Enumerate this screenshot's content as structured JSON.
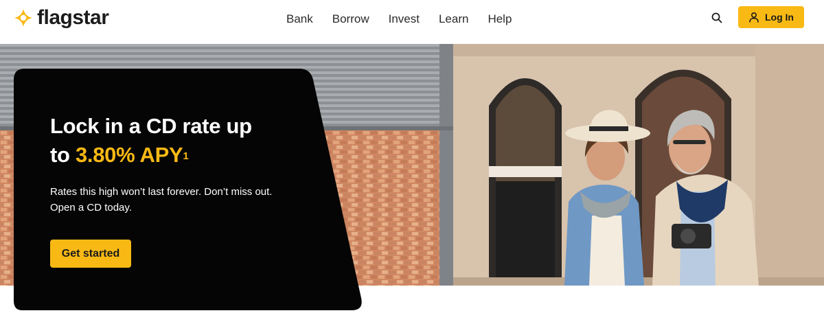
{
  "brand": {
    "name": "flagstar",
    "accent": "#f9b915"
  },
  "nav": {
    "items": [
      "Bank",
      "Borrow",
      "Invest",
      "Learn",
      "Help"
    ]
  },
  "header": {
    "search_icon": "search-icon",
    "login_label": "Log In",
    "login_icon": "user-icon"
  },
  "hero": {
    "title_line1": "Lock in a CD rate up",
    "title_prefix": "to ",
    "title_rate": "3.80% APY",
    "title_footnote": "1",
    "subtitle": "Rates this high won’t last forever. Don’t miss out. Open a CD today.",
    "cta_label": "Get started",
    "card_color": "#050505"
  }
}
